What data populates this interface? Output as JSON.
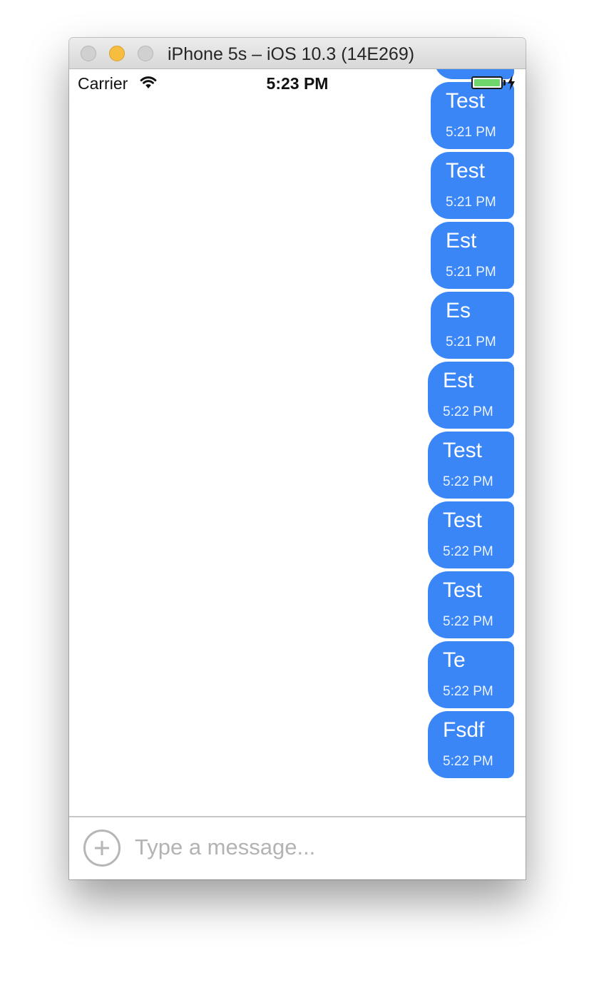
{
  "window": {
    "title": "iPhone 5s – iOS 10.3 (14E269)"
  },
  "status_bar": {
    "carrier": "Carrier",
    "time": "5:23 PM",
    "battery_icon": "battery-charging-icon",
    "wifi_icon": "wifi-icon"
  },
  "messages": [
    {
      "text": "Test",
      "time": "5:21 PM"
    },
    {
      "text": "Test",
      "time": "5:21 PM"
    },
    {
      "text": "Est",
      "time": "5:21 PM"
    },
    {
      "text": "Es",
      "time": "5:21 PM"
    },
    {
      "text": "Est",
      "time": "5:22 PM"
    },
    {
      "text": "Test",
      "time": "5:22 PM"
    },
    {
      "text": "Test",
      "time": "5:22 PM"
    },
    {
      "text": "Test",
      "time": "5:22 PM"
    },
    {
      "text": "Te",
      "time": "5:22 PM"
    },
    {
      "text": "Fsdf",
      "time": "5:22 PM"
    }
  ],
  "composer": {
    "placeholder": "Type a message...",
    "add_icon": "plus-circle-icon"
  },
  "colors": {
    "bubble": "#3a86f7",
    "battery_fill": "#6fd66b",
    "minimize_button": "#f6bd3e"
  }
}
